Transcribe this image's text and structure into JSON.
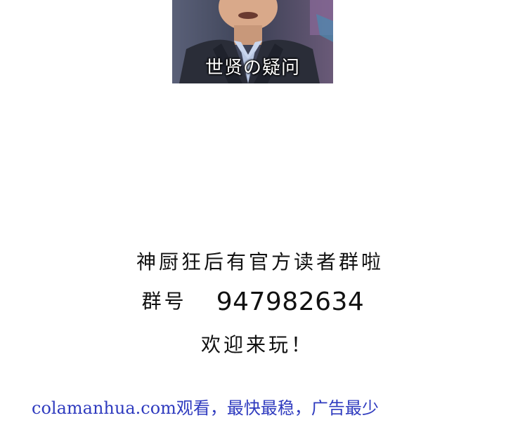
{
  "image": {
    "caption": "世贤の疑问",
    "colors": {
      "suit": "#2a2d38",
      "shirt": "#c9d6ee",
      "skin": "#d9a98a",
      "background": "#4a5068"
    }
  },
  "notice": {
    "line1": "神厨狂后有官方读者群啦",
    "group_label": "群号",
    "group_number": "947982634",
    "line3": "欢迎来玩！"
  },
  "watermark": {
    "text": "colamanhua.com观看，最快最稳，广告最少",
    "color": "#2f3bbf"
  }
}
